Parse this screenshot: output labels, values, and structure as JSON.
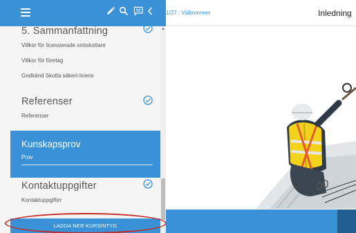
{
  "colors": {
    "accent": "#3a91d6",
    "highlight": "#c62828"
  },
  "toolbar": {
    "icons": [
      "menu-icon",
      "pencil-icon",
      "search-icon",
      "comment-icon",
      "chevron-left-icon"
    ]
  },
  "sidebar": {
    "sections": [
      {
        "title": "5. Sammanfattning",
        "completed": true,
        "items": [
          "Villkor för licensierade snöskottare",
          "Villkor för företag",
          "Godkänd Skotta säkert-licens"
        ]
      },
      {
        "title": "Referenser",
        "completed": true,
        "items": [
          "Referenser"
        ]
      },
      {
        "title": "Kunskapsprov",
        "active": true,
        "items": [
          "Prov"
        ]
      },
      {
        "title": "Kontaktuppgifter",
        "completed": true,
        "items": [
          "Kontaktuppgifter"
        ]
      }
    ],
    "download_label": "LADDA NER KURSINTYG"
  },
  "main": {
    "breadcrumb": "1/27 : Välkommen",
    "title": "Inledning"
  }
}
